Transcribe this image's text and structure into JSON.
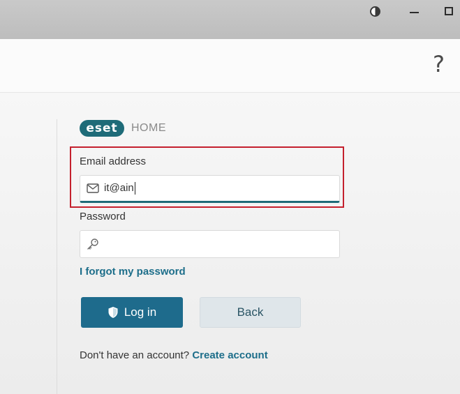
{
  "titlebar": {
    "theme_icon": "contrast-icon",
    "minimize_icon": "minimize-icon",
    "maximize_icon": "maximize-icon"
  },
  "header": {
    "help": "?"
  },
  "brand": {
    "logo": "eset",
    "product": "HOME",
    "logo_color": "#1e6b78"
  },
  "email": {
    "label": "Email address",
    "value": "it@ain",
    "icon": "mail-icon"
  },
  "password": {
    "label": "Password",
    "value": "",
    "icon": "key-icon"
  },
  "links": {
    "forgot": "I forgot my password"
  },
  "buttons": {
    "login": "Log in",
    "back": "Back"
  },
  "signup": {
    "prompt": "Don't have an account?",
    "create": "Create account"
  },
  "colors": {
    "accent": "#1e6b8c",
    "highlight": "#c4202d",
    "link": "#1d6e8a"
  }
}
